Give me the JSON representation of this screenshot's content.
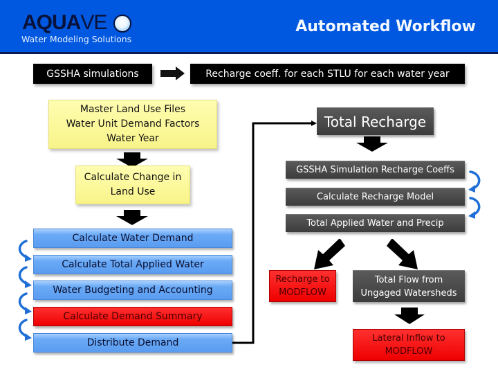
{
  "header": {
    "logo": {
      "bold_part": "AQUA",
      "light_part": "VE",
      "circle_letter": "O",
      "tagline": "Water Modeling Solutions"
    },
    "title": "Automated Workflow"
  },
  "top_row": {
    "input_box": "GSSHA simulations",
    "output_box": "Recharge coeff. for each STLU for each water year"
  },
  "left_column": {
    "inputs_box": [
      "Master Land Use Files",
      "Water Unit Demand Factors",
      "Water Year"
    ],
    "change_box": [
      "Calculate Change in",
      "Land Use"
    ],
    "steps": [
      {
        "label": "Calculate Water Demand",
        "color": "#5a9cf0"
      },
      {
        "label": "Calculate Total Applied Water",
        "color": "#5a9cf0"
      },
      {
        "label": "Water Budgeting and Accounting",
        "color": "#5a9cf0"
      },
      {
        "label": "Calculate Demand Summary",
        "color": "#ee0000"
      },
      {
        "label": "Distribute Demand",
        "color": "#5a9cf0"
      }
    ]
  },
  "right_column": {
    "total_recharge": "Total Recharge",
    "steps": [
      "GSSHA Simulation Recharge Coeffs",
      "Calculate Recharge Model",
      "Total Applied Water and Precip"
    ],
    "recharge_output": [
      "Recharge to",
      "MODFLOW"
    ],
    "total_flow": [
      "Total Flow from",
      "Ungaged Watersheds"
    ],
    "lateral_inflow": [
      "Lateral Inflow to",
      "MODFLOW"
    ]
  },
  "colors": {
    "header_blue": "#0058e0",
    "process_blue": "#5a9cf0",
    "output_red": "#ee0000",
    "input_yellow": "#f8f48a",
    "dark_step": "#444444",
    "loop_arrow_blue": "#1f6fd6"
  }
}
